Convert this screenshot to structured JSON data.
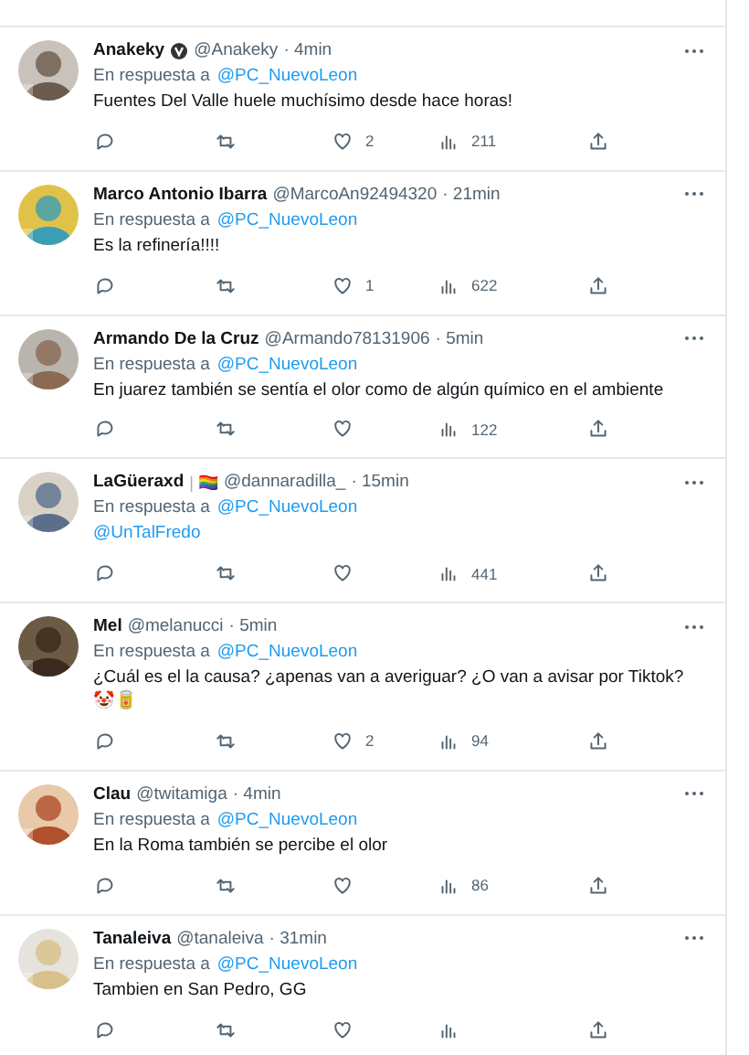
{
  "tweets": [
    {
      "name": "Anakeky",
      "verified": true,
      "handle": "@Anakeky",
      "time": "· 4min",
      "reply_prefix": "En respuesta a",
      "reply_to": "@PC_NuevoLeon",
      "text": "Fuentes Del Valle huele muchísimo desde hace horas!",
      "text_is_mention": false,
      "likes": "2",
      "views": "211"
    },
    {
      "name": "Marco Antonio Ibarra",
      "verified": false,
      "handle": "@MarcoAn92494320",
      "time": "· 21min",
      "reply_prefix": "En respuesta a",
      "reply_to": "@PC_NuevoLeon",
      "text": "Es la refinería!!!!",
      "text_is_mention": false,
      "likes": "1",
      "views": "622"
    },
    {
      "name": "Armando De la Cruz",
      "verified": false,
      "handle": "@Armando78131906",
      "time": "· 5min",
      "reply_prefix": "En respuesta a",
      "reply_to": "@PC_NuevoLeon",
      "text": "En juarez también se sentía el olor como de algún químico en el ambiente",
      "text_is_mention": false,
      "views": "122"
    },
    {
      "name": "LaGüeraxd",
      "name_suffix": "| 🏳️‍🌈",
      "verified": false,
      "handle": "@dannaradilla_",
      "time": "· 15min",
      "reply_prefix": "En respuesta a",
      "reply_to": "@PC_NuevoLeon",
      "text": "@UnTalFredo",
      "text_is_mention": true,
      "views": "441"
    },
    {
      "name": "Mel",
      "verified": false,
      "handle": "@melanucci",
      "time": "· 5min",
      "reply_prefix": "En respuesta a",
      "reply_to": "@PC_NuevoLeon",
      "text": "¿Cuál es el la causa? ¿apenas van a averiguar? ¿O van a avisar por Tiktok? 🤡🥫",
      "text_is_mention": false,
      "likes": "2",
      "views": "94"
    },
    {
      "name": "Clau",
      "verified": false,
      "handle": "@twitamiga",
      "time": "· 4min",
      "reply_prefix": "En respuesta a",
      "reply_to": "@PC_NuevoLeon",
      "text": "En la Roma también se percibe el olor",
      "text_is_mention": false,
      "views": "86"
    },
    {
      "name": "Tanaleiva",
      "verified": false,
      "handle": "@tanaleiva",
      "time": "· 31min",
      "reply_prefix": "En respuesta a",
      "reply_to": "@PC_NuevoLeon",
      "text": "Tambien en San Pedro, GG",
      "text_is_mention": false
    }
  ]
}
